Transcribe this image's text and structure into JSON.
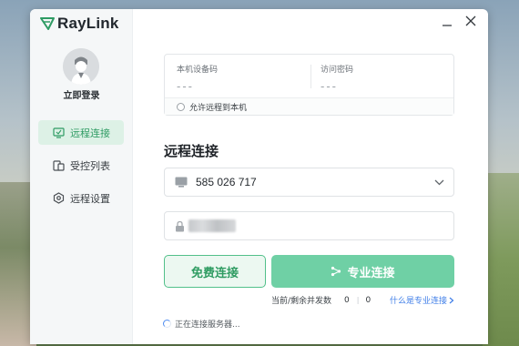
{
  "app": {
    "name": "RayLink",
    "brand_color": "#2e9b63"
  },
  "sidebar": {
    "login_label": "立即登录",
    "items": [
      {
        "label": "远程连接",
        "icon": "monitor-icon",
        "active": true
      },
      {
        "label": "受控列表",
        "icon": "devices-icon",
        "active": false
      },
      {
        "label": "远程设置",
        "icon": "hexagon-gear-icon",
        "active": false
      }
    ]
  },
  "window_controls": {
    "minimize_icon": "minimize-icon",
    "close_icon": "close-icon"
  },
  "device": {
    "code_label": "本机设备码",
    "code_value": "---",
    "password_label": "访问密码",
    "password_value": "---",
    "allow_remote_label": "允许远程到本机"
  },
  "connect": {
    "title": "远程连接",
    "id_value": "585 026 717",
    "free_button": "免费连接",
    "pro_button": "专业连接",
    "concurrency_label": "当前/剩余并发数",
    "concurrency_current": "0",
    "concurrency_remaining": "0",
    "pro_link": "什么是专业连接"
  },
  "status": {
    "text": "正在连接服务器..."
  }
}
